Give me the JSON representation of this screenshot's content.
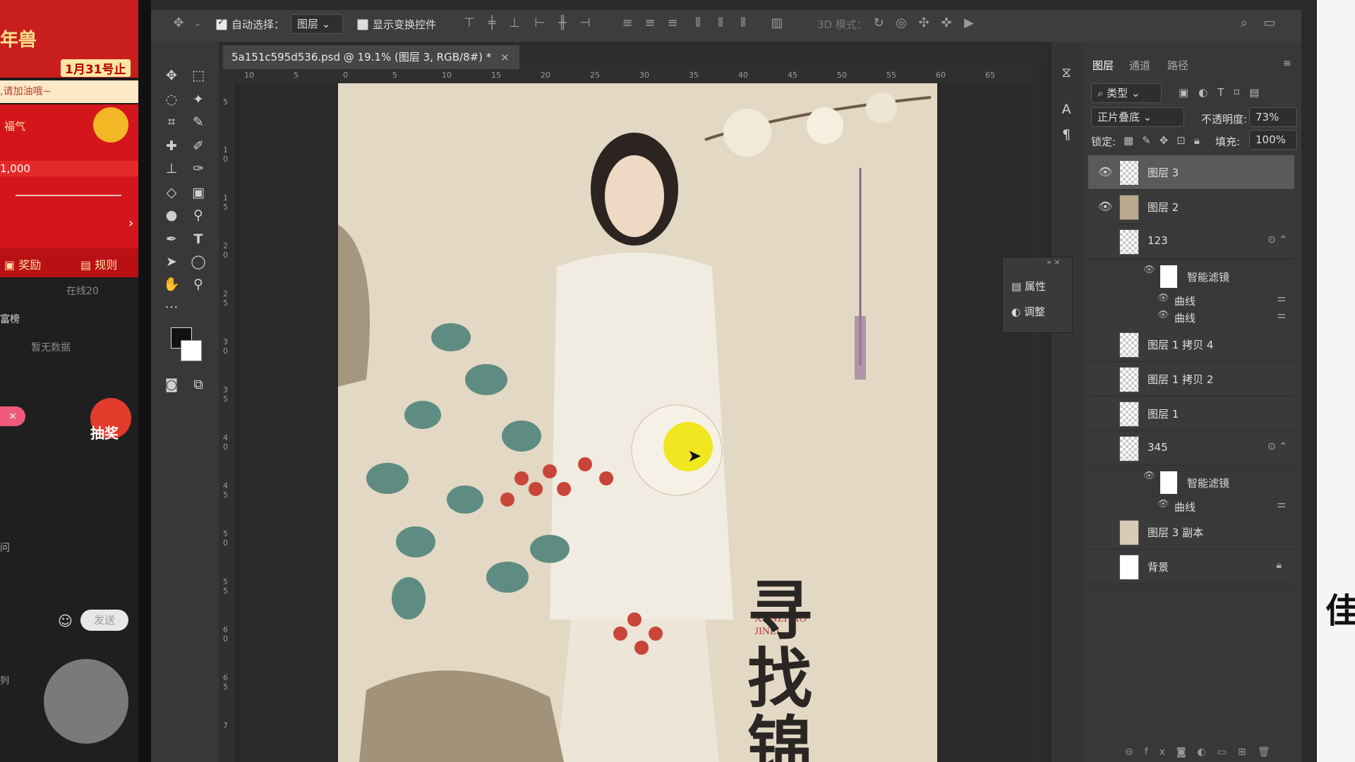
{
  "stream": {
    "banner_title": "年兽",
    "banner_date": "1月31号止",
    "cheer_text": ",请加油哦~",
    "fortune_label": "福气",
    "amount": "1,000",
    "reward_label": "奖励",
    "rules_label": "规则",
    "online_text": "在线20",
    "rank_label": "富榜",
    "no_data_text": "暂无数据",
    "lottery_label": "抽奖",
    "side_char": "问",
    "send_button": "发送",
    "list_char": "列"
  },
  "toolbar": {
    "auto_select_label": "自动选择：",
    "auto_select_checked": true,
    "layer_select_value": "图层",
    "show_transform_label": "显示变换控件",
    "show_transform_checked": false,
    "mode_3d_label": "3D 模式："
  },
  "document": {
    "tab_title": "5a151c595d536.psd @ 19.1% (图层 3, RGB/8#) *",
    "ruler_h": [
      "10",
      "5",
      "0",
      "5",
      "10",
      "15",
      "20",
      "25",
      "30",
      "35",
      "40",
      "45",
      "50",
      "55",
      "60",
      "65"
    ],
    "ruler_v": [
      "5",
      "1 0",
      "1 5",
      "2 0",
      "2 5",
      "3 0",
      "3 5",
      "4 0",
      "4 5",
      "5 0",
      "5 5",
      "6 0",
      "6 5",
      "7"
    ],
    "poster_title_cn": "寻找锦",
    "poster_title_en_1": "XUNZHAO",
    "poster_title_en_2": "JINLI"
  },
  "float_panel": {
    "properties_label": "属性",
    "adjust_label": "调整"
  },
  "right_icons": {
    "a_glyph": "A",
    "para_glyph": "¶"
  },
  "layers_panel": {
    "tabs": [
      "图层",
      "通道",
      "路径"
    ],
    "filter_label": "类型",
    "blend_mode": "正片叠底",
    "opacity_label": "不透明度:",
    "opacity_value": "73%",
    "lock_label": "锁定:",
    "fill_label": "填充:",
    "fill_value": "100%",
    "layers": [
      {
        "name": "图层 3",
        "visible": true,
        "selected": true
      },
      {
        "name": "图层 2",
        "visible": true,
        "selected": false
      },
      {
        "name": "123",
        "visible": false,
        "selected": false
      },
      {
        "name": "智能滤镜",
        "sub": true
      },
      {
        "name": "曲线",
        "sub": true
      },
      {
        "name": "曲线",
        "sub": true
      },
      {
        "name": "图层 1 拷贝 4",
        "visible": false
      },
      {
        "name": "图层 1 拷贝 2",
        "visible": false
      },
      {
        "name": "图层 1",
        "visible": false
      },
      {
        "name": "345",
        "visible": false
      },
      {
        "name": "智能滤镜",
        "sub": true
      },
      {
        "name": "曲线",
        "sub": true
      },
      {
        "name": "图层 3 副本",
        "visible": false
      },
      {
        "name": "背景",
        "visible": false,
        "locked": true
      }
    ]
  },
  "edge_char": "佳",
  "colors": {
    "accent_red": "#d4161c",
    "ps_panel": "#383838",
    "poster_bg": "#e3d8c4"
  }
}
